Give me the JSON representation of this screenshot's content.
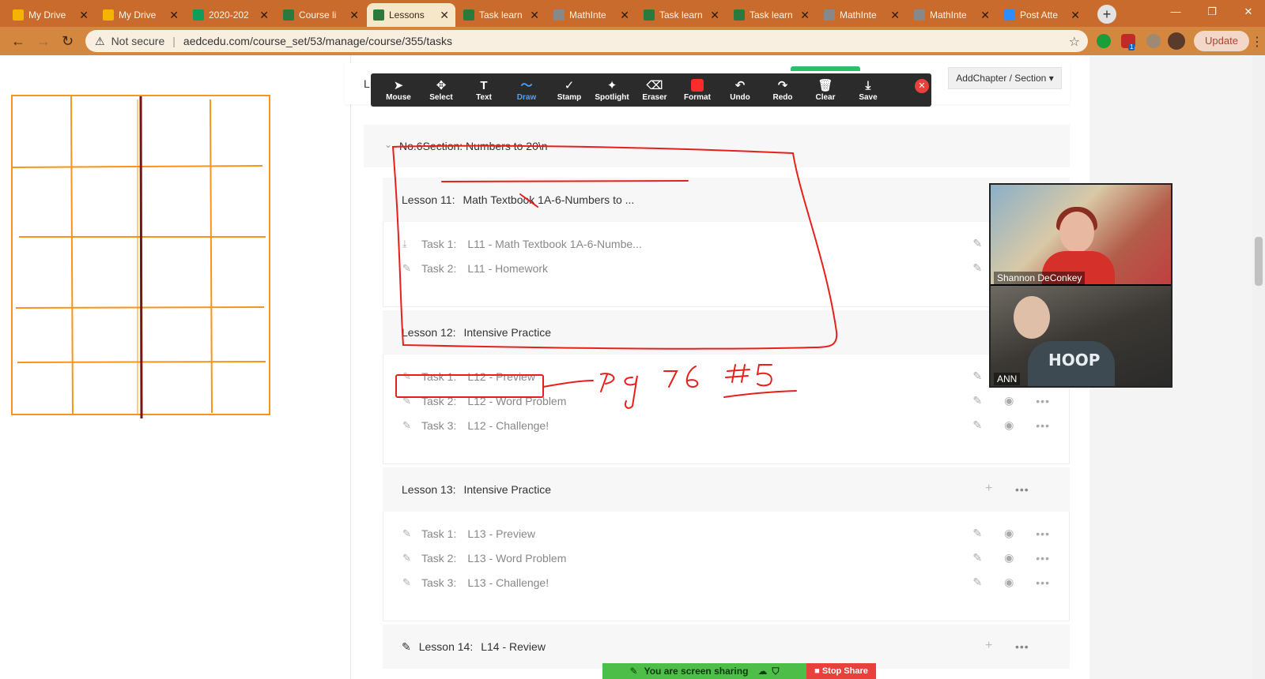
{
  "browser": {
    "tabs": [
      {
        "title": "My Drive",
        "icon": "google-drive-icon",
        "color": "#f4b400"
      },
      {
        "title": "My Drive",
        "icon": "google-drive-icon",
        "color": "#f4b400"
      },
      {
        "title": "2020-202",
        "icon": "google-sheets-icon",
        "color": "#0f9d58"
      },
      {
        "title": "Course li",
        "icon": "course-app-icon",
        "color": "#2b7a3d"
      },
      {
        "title": "Lessons",
        "icon": "course-app-icon",
        "color": "#2b7a3d"
      },
      {
        "title": "Task learn",
        "icon": "course-app-icon",
        "color": "#2b7a3d"
      },
      {
        "title": "MathInte",
        "icon": "globe-icon",
        "color": "#888888"
      },
      {
        "title": "Task learn",
        "icon": "course-app-icon",
        "color": "#2b7a3d"
      },
      {
        "title": "Task learn",
        "icon": "course-app-icon",
        "color": "#2b7a3d"
      },
      {
        "title": "MathInte",
        "icon": "globe-icon",
        "color": "#888888"
      },
      {
        "title": "MathInte",
        "icon": "globe-icon",
        "color": "#888888"
      },
      {
        "title": "Post Atte",
        "icon": "zoom-icon",
        "color": "#2d8cff"
      }
    ],
    "active_tab_index": 4,
    "security_label": "Not secure",
    "url": "aedcedu.com/course_set/53/manage/course/355/tasks",
    "update_label": "Update",
    "ext_badge": "1"
  },
  "annotate_toolbar": {
    "tools": [
      {
        "label": "Mouse",
        "icon": "mouse-pointer-icon",
        "glyph": "➤"
      },
      {
        "label": "Select",
        "icon": "move-icon",
        "glyph": "✥"
      },
      {
        "label": "Text",
        "icon": "text-icon",
        "glyph": "T"
      },
      {
        "label": "Draw",
        "icon": "draw-icon",
        "glyph": "〜"
      },
      {
        "label": "Stamp",
        "icon": "checkmark-icon",
        "glyph": "✓"
      },
      {
        "label": "Spotlight",
        "icon": "spotlight-icon",
        "glyph": "✦"
      },
      {
        "label": "Eraser",
        "icon": "eraser-icon",
        "glyph": "⌫"
      },
      {
        "label": "Format",
        "icon": "color-swatch-icon",
        "glyph": ""
      },
      {
        "label": "Undo",
        "icon": "undo-icon",
        "glyph": "↶"
      },
      {
        "label": "Redo",
        "icon": "redo-icon",
        "glyph": "↷"
      },
      {
        "label": "Clear",
        "icon": "trash-icon",
        "glyph": "🗑"
      },
      {
        "label": "Save",
        "icon": "save-icon",
        "glyph": "⤓"
      }
    ],
    "active_tool": "Draw"
  },
  "course": {
    "partial_header_letter": "L",
    "add_chapter_label": "AddChapter / Section",
    "section": {
      "label": "No.6Section:  Numbers to 20\\n"
    },
    "lessons": [
      {
        "name": "Lesson 11:",
        "title": "Math Textbook 1A-6-Numbers to ...",
        "tasks": [
          {
            "name": "Task 1:",
            "title": "L11 - Math Textbook 1A-6-Numbe...",
            "icon": "download-icon"
          },
          {
            "name": "Task 2:",
            "title": "L11 - Homework",
            "icon": "pencil-icon"
          }
        ]
      },
      {
        "name": "Lesson 12:",
        "title": "Intensive Practice",
        "tasks": [
          {
            "name": "Task 1:",
            "title": "L12 - Preview",
            "icon": "pencil-icon"
          },
          {
            "name": "Task 2:",
            "title": "L12 - Word Problem",
            "icon": "pencil-icon"
          },
          {
            "name": "Task 3:",
            "title": "L12 - Challenge!",
            "icon": "pencil-icon"
          }
        ]
      },
      {
        "name": "Lesson 13:",
        "title": "Intensive Practice",
        "tasks": [
          {
            "name": "Task 1:",
            "title": "L13 - Preview",
            "icon": "pencil-icon"
          },
          {
            "name": "Task 2:",
            "title": "L13 - Word Problem",
            "icon": "pencil-icon"
          },
          {
            "name": "Task 3:",
            "title": "L13 - Challenge!",
            "icon": "pencil-icon"
          }
        ]
      },
      {
        "name": "Lesson 14:",
        "title": "L14 - Review",
        "tasks": []
      }
    ]
  },
  "video": {
    "participants": [
      "Shannon DeConkey",
      "ANN"
    ],
    "shirt_text": "HOOP"
  },
  "share_bar": {
    "status": "You are screen sharing",
    "stop_label": "Stop Share"
  },
  "annotations": {
    "handwritten": "pg 76 #5",
    "ink_color": "#e8201c",
    "grid_color": "#f7941d"
  }
}
